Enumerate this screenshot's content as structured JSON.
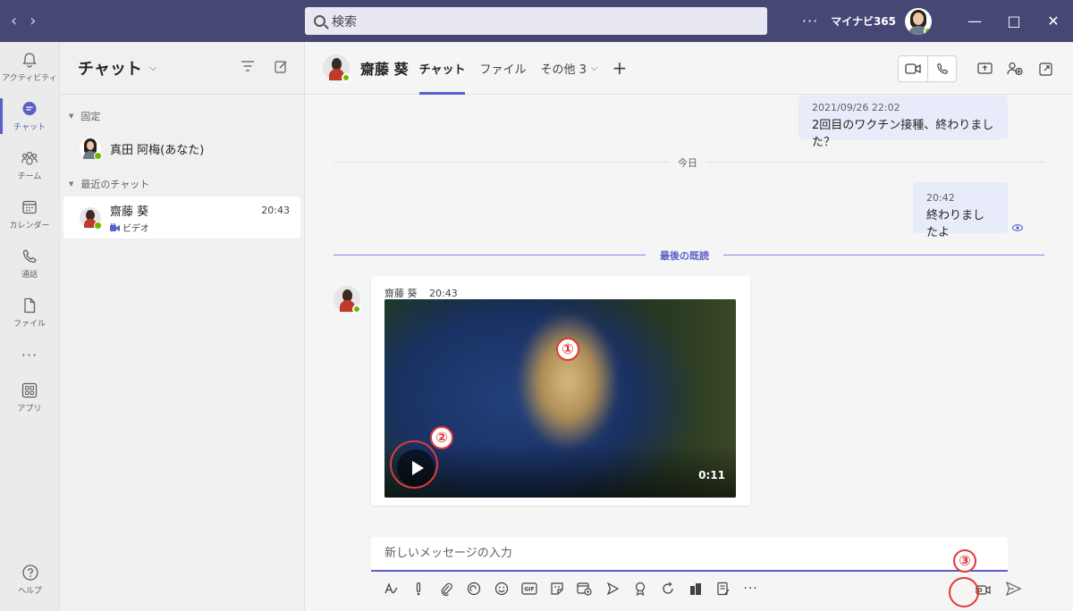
{
  "titlebar": {
    "search_placeholder": "検索",
    "more": "···",
    "org_name": "マイナビ365"
  },
  "rail": {
    "items": [
      {
        "label": "アクティビティ"
      },
      {
        "label": "チャット"
      },
      {
        "label": "チーム"
      },
      {
        "label": "カレンダー"
      },
      {
        "label": "通話"
      },
      {
        "label": "ファイル"
      },
      {
        "label": "アプリ"
      }
    ],
    "more": "···",
    "help": "ヘルプ"
  },
  "chatlist": {
    "title": "チャット",
    "pinned_label": "固定",
    "recent_label": "最近のチャット",
    "pinned": [
      {
        "name": "真田 阿梅(あなた)"
      }
    ],
    "recent": [
      {
        "name": "齋藤 葵",
        "sub": "ビデオ",
        "time": "20:43"
      }
    ]
  },
  "conversation": {
    "contact_name": "齋藤 葵",
    "tabs": [
      "チャット",
      "ファイル",
      "その他 3"
    ],
    "messages_me": [
      {
        "time": "2021/09/26 22:02",
        "text": "2回目のワクチン接種、終わりました？"
      },
      {
        "time": "20:42",
        "text": "終わりましたよ"
      }
    ],
    "divider_today": "今日",
    "divider_last_read": "最後の既読",
    "incoming": {
      "name": "齋藤 葵",
      "time": "20:43",
      "duration": "0:11"
    },
    "compose_placeholder": "新しいメッセージの入力"
  },
  "annotations": [
    "①",
    "②",
    "③"
  ],
  "colors": {
    "brand": "#464775",
    "accent": "#5b5fc7",
    "bubble_me": "#e8ebfa",
    "annotation": "#e03a3a",
    "presence": "#6bb700"
  }
}
